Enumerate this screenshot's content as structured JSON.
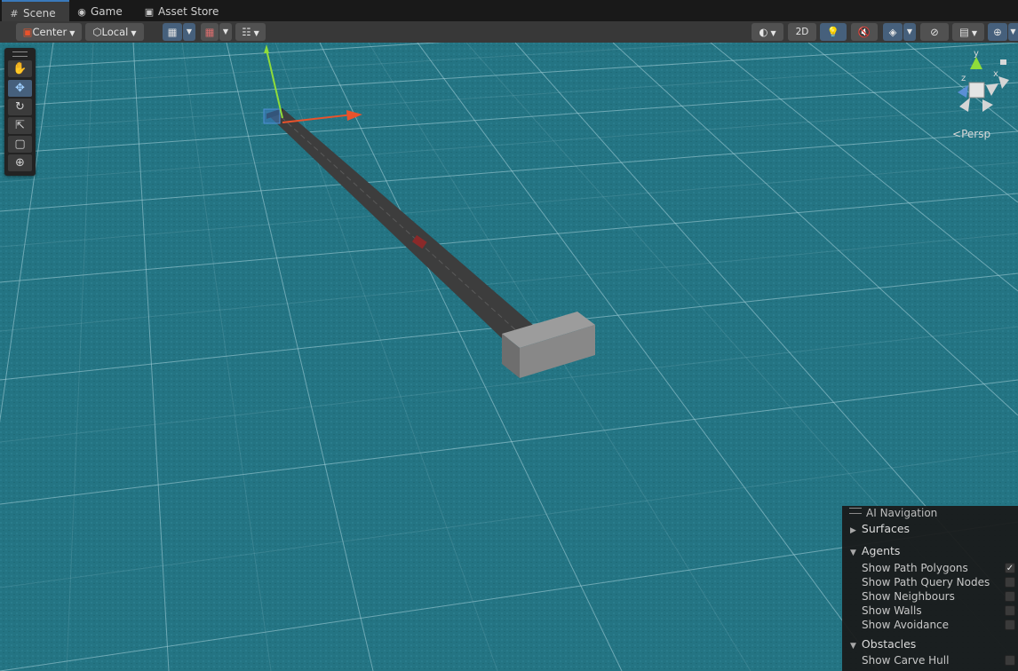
{
  "tabs": [
    {
      "label": "Scene",
      "icon": "grid-icon",
      "active": true
    },
    {
      "label": "Game",
      "icon": "gamepad-icon",
      "active": false
    },
    {
      "label": "Asset Store",
      "icon": "shopping-bag-icon",
      "active": false
    }
  ],
  "toolbar": {
    "pivot_label": "Center",
    "space_label": "Local",
    "mode_2d_label": "2D"
  },
  "scene_view": {
    "projection_label": "Persp",
    "gizmo_axes": [
      "y",
      "z",
      "x"
    ],
    "colors": {
      "ground": "#237381",
      "x_axis": "#e8532c",
      "y_axis": "#8fdc3a",
      "selection": "#3a79bb"
    }
  },
  "tools": [
    "hand-tool",
    "move-tool",
    "rotate-tool",
    "scale-tool",
    "rect-tool",
    "transform-tool"
  ],
  "ai_navigation": {
    "title": "AI Navigation",
    "sections": [
      {
        "label": "Surfaces",
        "expanded": false,
        "options": []
      },
      {
        "label": "Agents",
        "expanded": true,
        "options": [
          {
            "label": "Show Path Polygons",
            "checked": true
          },
          {
            "label": "Show Path Query Nodes",
            "checked": false
          },
          {
            "label": "Show Neighbours",
            "checked": false
          },
          {
            "label": "Show Walls",
            "checked": false
          },
          {
            "label": "Show Avoidance",
            "checked": false
          }
        ]
      },
      {
        "label": "Obstacles",
        "expanded": true,
        "options": [
          {
            "label": "Show Carve Hull",
            "checked": false
          }
        ]
      }
    ]
  }
}
